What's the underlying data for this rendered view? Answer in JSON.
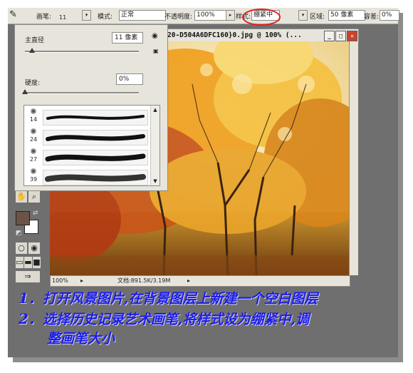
{
  "options_bar": {
    "brush_label": "画笔:",
    "brush_size": "11",
    "mode_label": "模式:",
    "mode_value": "正常",
    "opacity_label": "不透明度:",
    "opacity_value": "100%",
    "style_label": "样式:",
    "style_value": "绷紧中",
    "area_label": "区域:",
    "area_value": "50 像素",
    "tolerance_label": "容差:",
    "tolerance_value": "0%"
  },
  "brush_panel": {
    "diameter_label": "主直径",
    "diameter_value": "11 像素",
    "diameter_level": 0.06,
    "hardness_label": "硬度:",
    "hardness_value": "0%",
    "hardness_level": 0.0,
    "presets": [
      {
        "size": "14"
      },
      {
        "size": "24"
      },
      {
        "size": "27"
      },
      {
        "size": "39"
      }
    ]
  },
  "document": {
    "title": "20-D504A6DFC160}0.jpg @ 100% (...",
    "zoom": "100%",
    "doc_size": "文档:891.5K/3.19M"
  },
  "captions": [
    {
      "num": "1．",
      "text": "打开风景图片,在背景图层上新建一个空白图层"
    },
    {
      "num": "2．",
      "text": "选择历史记录艺术画笔,将样式设为绷紧中,调"
    },
    {
      "num": "",
      "text": "整画笔大小"
    }
  ],
  "colors": {
    "foreground": "#6b5447",
    "background": "#ffffff",
    "caption": "#1d1de8",
    "highlight_ring": "#e02020"
  }
}
